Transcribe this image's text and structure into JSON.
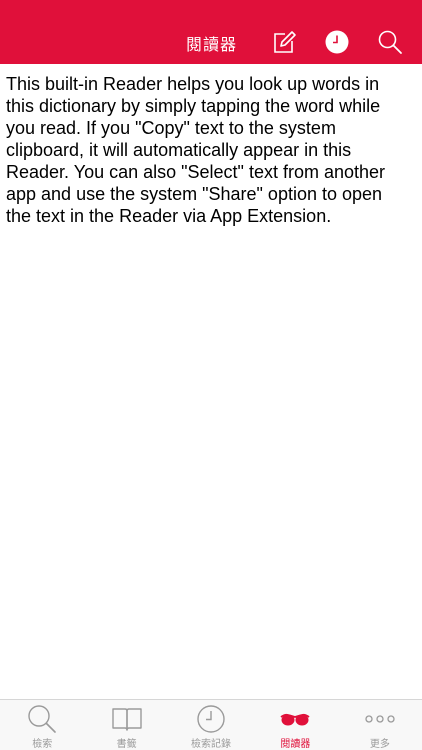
{
  "navbar": {
    "title": "閱讀器",
    "icons": {
      "edit": "compose-icon",
      "history": "clock-icon",
      "search": "search-icon"
    },
    "background": "#e0103a"
  },
  "content": {
    "text": "This built-in Reader helps you look up words in this dictionary by simply tapping the word while you read. If you \"Copy\" text to the system clipboard, it will automatically appear in this Reader. You can also \"Select\" text from another app and use the system \"Share\" option to open the text in the Reader via App Extension."
  },
  "tabbar": {
    "items": [
      {
        "label": "檢索",
        "icon": "magnifier-icon",
        "active": false
      },
      {
        "label": "書籤",
        "icon": "book-icon",
        "active": false
      },
      {
        "label": "檢索記錄",
        "icon": "clock-icon",
        "active": false
      },
      {
        "label": "閱讀器",
        "icon": "glasses-icon",
        "active": true
      },
      {
        "label": "更多",
        "icon": "more-dots-icon",
        "active": false
      }
    ],
    "active_color": "#e0103a",
    "inactive_color": "#9a9a9a"
  }
}
